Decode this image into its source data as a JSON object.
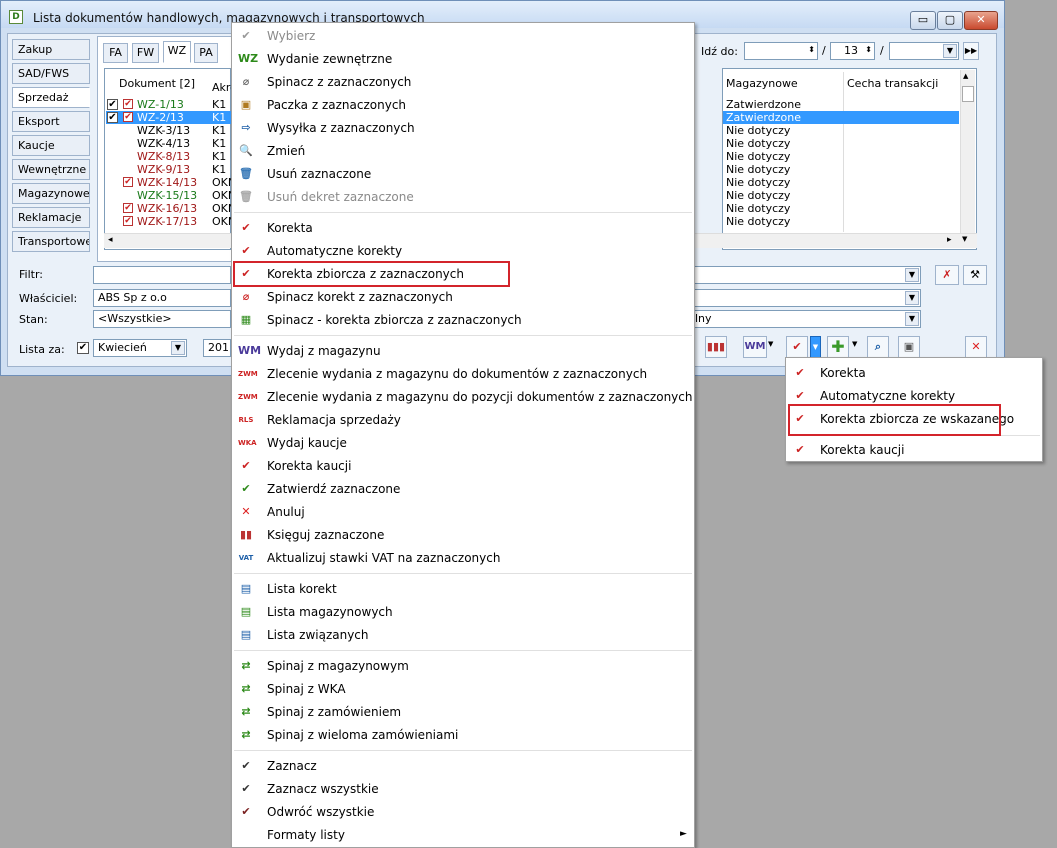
{
  "window": {
    "title": "Lista dokumentów handlowych, magazynowych i transportowych",
    "buttons": [
      "▭",
      "▢",
      "✕"
    ]
  },
  "side_tabs": [
    "Zakup",
    "SAD/FWS",
    "Sprzedaż",
    "Eksport",
    "Kaucje",
    "Wewnętrzne",
    "Magazynowe",
    "Reklamacje",
    "Transportowe"
  ],
  "doc_tabs": [
    "FA",
    "FW",
    "WZ",
    "PA"
  ],
  "goto": {
    "label": "Idź do:",
    "sep1": "/",
    "month": "13",
    "sep2": "/"
  },
  "list": {
    "col_doc": "Dokument [2]",
    "col_akr": "Akro",
    "rows": [
      {
        "doc": "WZ-1/13",
        "akr": "K1"
      },
      {
        "doc": "WZ-2/13",
        "akr": "K1"
      },
      {
        "doc": "WZK-3/13",
        "akr": "K1"
      },
      {
        "doc": "WZK-4/13",
        "akr": "K1"
      },
      {
        "doc": "WZK-8/13",
        "akr": "K1"
      },
      {
        "doc": "WZK-9/13",
        "akr": "K1"
      },
      {
        "doc": "WZK-14/13",
        "akr": "OKN"
      },
      {
        "doc": "WZK-15/13",
        "akr": "OKN"
      },
      {
        "doc": "WZK-16/13",
        "akr": "OKN"
      },
      {
        "doc": "WZK-17/13",
        "akr": "OKN"
      }
    ],
    "col_mag": "Magazynowe",
    "col_cecha": "Cecha transakcji",
    "mag_values": [
      "Zatwierdzone",
      "Zatwierdzone",
      "Nie dotyczy",
      "Nie dotyczy",
      "Nie dotyczy",
      "Nie dotyczy",
      "Nie dotyczy",
      "Nie dotyczy",
      "Nie dotyczy",
      "Nie dotyczy"
    ]
  },
  "filters": {
    "filtr_label": "Filtr:",
    "wlasciciel_label": "Właściciel:",
    "wlasciciel_value": "ABS Sp z o.o",
    "stan_label": "Stan:",
    "stan_value": "<Wszystkie>",
    "stan_right_value": "lny",
    "lista_za_label": "Lista za:",
    "month_value": "Kwiecień",
    "year_value": "201"
  },
  "menu": [
    {
      "label": "Wybierz",
      "icon": "check-icon",
      "glyph": "✔",
      "disabled": true
    },
    {
      "label": "Wydanie zewnętrzne",
      "icon": "wz-icon",
      "glyph": "WZ"
    },
    {
      "label": "Spinacz  z zaznaczonych",
      "icon": "paperclip-icon",
      "glyph": "⌀"
    },
    {
      "label": "Paczka  z zaznaczonych",
      "icon": "package-icon",
      "glyph": "▣"
    },
    {
      "label": "Wysyłka  z zaznaczonych",
      "icon": "shipping-icon",
      "glyph": "⇨"
    },
    {
      "label": "Zmień",
      "icon": "magnifier-icon",
      "glyph": "🔍"
    },
    {
      "label": "Usuń zaznaczone",
      "icon": "trash-icon",
      "glyph": "🗑"
    },
    {
      "label": "Usuń dekret zaznaczone",
      "icon": "trash-disabled-icon",
      "glyph": "🗑",
      "disabled": true
    },
    {
      "label": "Korekta",
      "icon": "correction-icon",
      "glyph": "✔"
    },
    {
      "label": "Automatyczne korekty",
      "icon": "auto-correction-icon",
      "glyph": "✔"
    },
    {
      "label": "Korekta zbiorcza z zaznaczonych",
      "icon": "collective-correction-icon",
      "glyph": "✔"
    },
    {
      "label": "Spinacz korekt z zaznaczonych",
      "icon": "paperclip-correction-icon",
      "glyph": "⌀"
    },
    {
      "label": "Spinacz - korekta zbiorcza z zaznaczonych",
      "icon": "paperclip-collective-icon",
      "glyph": "▦"
    },
    {
      "label": "Wydaj z magazynu",
      "icon": "wm-icon",
      "glyph": "WM"
    },
    {
      "label": "Zlecenie wydania z magazynu do dokumentów z zaznaczonych",
      "icon": "zwm-icon",
      "glyph": "ZWM"
    },
    {
      "label": "Zlecenie wydania z magazynu do pozycji dokumentów z zaznaczonych",
      "icon": "zwm-icon",
      "glyph": "ZWM"
    },
    {
      "label": "Reklamacja sprzedaży",
      "icon": "rls-icon",
      "glyph": "RLS"
    },
    {
      "label": "Wydaj kaucje",
      "icon": "wka-icon",
      "glyph": "WKA"
    },
    {
      "label": "Korekta kaucji",
      "icon": "deposit-correction-icon",
      "glyph": "✔"
    },
    {
      "label": "Zatwierdź zaznaczone",
      "icon": "approve-icon",
      "glyph": "✔"
    },
    {
      "label": "Anuluj",
      "icon": "cancel-icon",
      "glyph": "✕"
    },
    {
      "label": "Księguj zaznaczone",
      "icon": "ledger-icon",
      "glyph": "▮▮"
    },
    {
      "label": "Aktualizuj stawki VAT na zaznaczonych",
      "icon": "vat-icon",
      "glyph": "VAT"
    },
    {
      "label": "Lista korekt",
      "icon": "correction-list-icon",
      "glyph": "▤"
    },
    {
      "label": "Lista magazynowych",
      "icon": "warehouse-list-icon",
      "glyph": "▤"
    },
    {
      "label": "Lista związanych",
      "icon": "related-list-icon",
      "glyph": "▤"
    },
    {
      "label": "Spinaj z magazynowym",
      "icon": "link-icon",
      "glyph": "⇄"
    },
    {
      "label": "Spinaj z WKA",
      "icon": "link-icon",
      "glyph": "⇄"
    },
    {
      "label": "Spinaj z zamówieniem",
      "icon": "link-icon",
      "glyph": "⇄"
    },
    {
      "label": "Spinaj z wieloma zamówieniami",
      "icon": "link-icon",
      "glyph": "⇄"
    },
    {
      "label": "Zaznacz",
      "icon": "mark-icon",
      "glyph": "✔"
    },
    {
      "label": "Zaznacz wszystkie",
      "icon": "mark-all-icon",
      "glyph": "✔"
    },
    {
      "label": "Odwróć wszystkie",
      "icon": "invert-icon",
      "glyph": "✔"
    },
    {
      "label": "Formaty listy",
      "icon": "",
      "glyph": "",
      "arrow": "►"
    }
  ],
  "submenu": [
    {
      "label": "Korekta",
      "icon": "correction-icon",
      "glyph": "✔"
    },
    {
      "label": "Automatyczne korekty",
      "icon": "auto-correction-icon",
      "glyph": "✔"
    },
    {
      "label": "Korekta zbiorcza ze wskazanego",
      "icon": "collective-correction-icon",
      "glyph": "✔"
    },
    {
      "label": "Korekta kaucji",
      "icon": "deposit-correction-icon",
      "glyph": "✔"
    }
  ],
  "toolbar": {
    "wm": "WM"
  },
  "colors": {
    "accent": "#3399ff",
    "highlight": "#d3242b",
    "window_bg": "#cfdff2",
    "desktop": "#a8a8a8"
  }
}
